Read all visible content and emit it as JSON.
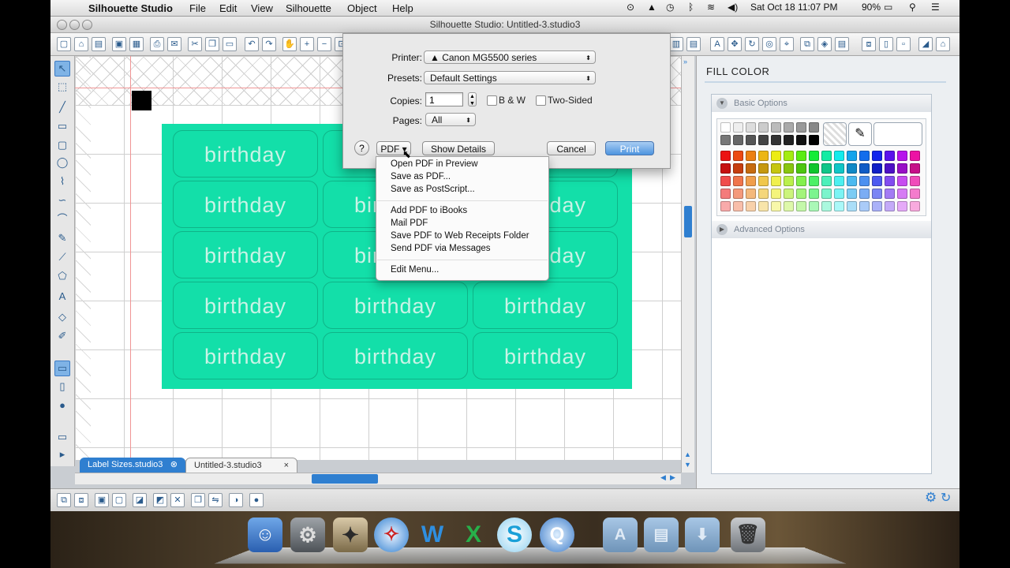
{
  "menubar": {
    "app_name": "Silhouette Studio",
    "menus": [
      "File",
      "Edit",
      "View",
      "Silhouette",
      "Object",
      "Help"
    ],
    "battery": "90%",
    "clock": "Sat Oct 18  11:07 PM"
  },
  "window": {
    "title": "Silhouette Studio: Untitled-3.studio3"
  },
  "canvas": {
    "label_text": "birthday",
    "sheet_color": "#13dfa9"
  },
  "tabs": [
    {
      "label": "Label Sizes.studio3",
      "close": "⊗"
    },
    {
      "label": "Untitled-3.studio3",
      "close": "×"
    }
  ],
  "right_panel": {
    "title": "FILL COLOR",
    "basic_options": "Basic Options",
    "advanced_options": "Advanced Options"
  },
  "print_dialog": {
    "printer_label": "Printer:",
    "printer_value": "Canon MG5500 series",
    "presets_label": "Presets:",
    "presets_value": "Default Settings",
    "copies_label": "Copies:",
    "copies_value": "1",
    "bw_label": "B & W",
    "two_sided_label": "Two-Sided",
    "pages_label": "Pages:",
    "pages_value": "All",
    "help": "?",
    "pdf_button": "PDF ▾",
    "show_details": "Show Details",
    "cancel": "Cancel",
    "print": "Print"
  },
  "pdf_menu": {
    "group1": [
      "Open PDF in Preview",
      "Save as PDF...",
      "Save as PostScript..."
    ],
    "group2": [
      "Add PDF to iBooks",
      "Mail PDF",
      "Save PDF to Web Receipts Folder",
      "Send PDF via Messages"
    ],
    "group3": [
      "Edit Menu..."
    ]
  },
  "colors": {
    "accent": "#2f7fd0",
    "sheet": "#13dfa9"
  }
}
